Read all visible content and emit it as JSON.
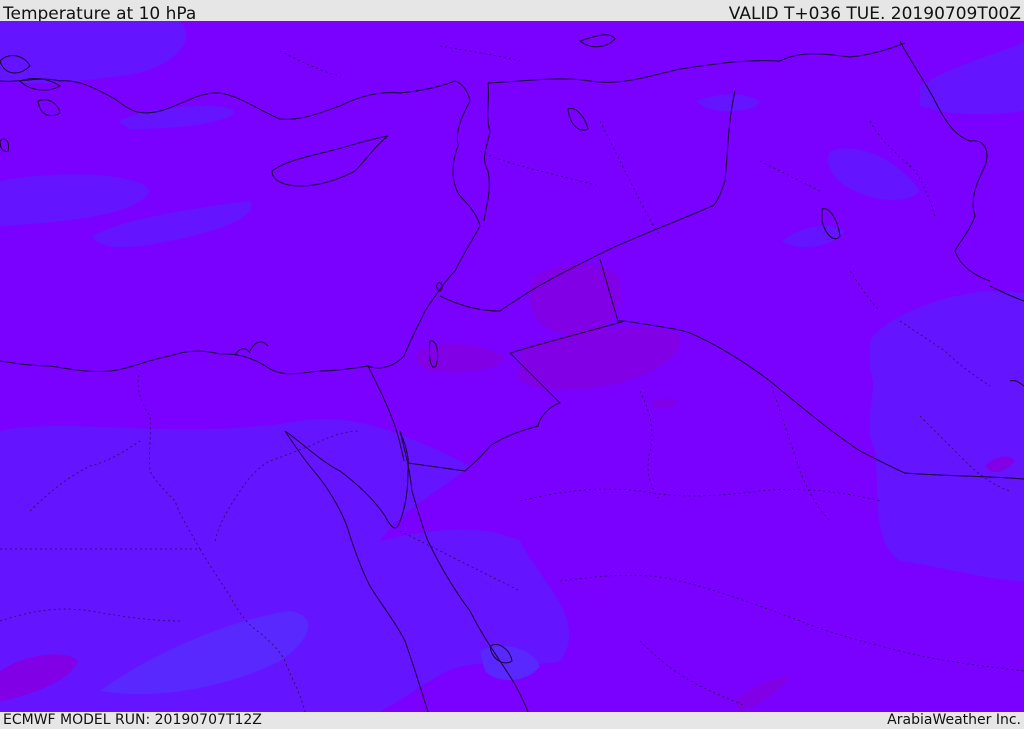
{
  "header": {
    "title": "Temperature at 10 hPa",
    "valid": "VALID T+036 TUE. 20190709T00Z"
  },
  "footer": {
    "model_run": "ECMWF MODEL RUN: 20190707T12Z",
    "credit": "ArabiaWeather Inc."
  },
  "colors": {
    "base_field": "#7a00ff",
    "cooler_field": "#6414ff",
    "coolest_field": "#5828ff",
    "warmer_field": "#8200e6",
    "coastline": "#1a0033"
  }
}
